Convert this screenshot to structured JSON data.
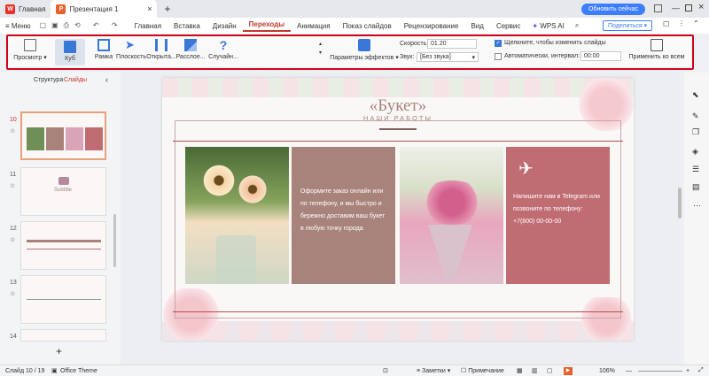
{
  "titlebar": {
    "home_tab": "Главная",
    "doc_tab": "Презентация 1",
    "update_button": "Обновить сейчас",
    "share_button": "Поделиться"
  },
  "menubar": {
    "menu": "Меню",
    "items": [
      "Главная",
      "Вставка",
      "Дизайн",
      "Переходы",
      "Анимация",
      "Показ слайдов",
      "Рецензирование",
      "Вид",
      "Сервис"
    ],
    "wps_ai": "WPS AI"
  },
  "ribbon": {
    "preview": "Просмотр",
    "transitions": [
      "Куб",
      "Рамка",
      "Плоскость",
      "Открыта...",
      "Расслое...",
      "Случайн..."
    ],
    "effect_params": "Параметры эффектов",
    "speed_label": "Скорость:",
    "speed_value": "01.20",
    "sound_label": "Звук:",
    "sound_value": "[Без звука]",
    "click_label": "Щелкните, чтобы изменить слайды",
    "auto_label": "Автоматически, интервал:",
    "auto_value": "00:00",
    "apply_all": "Применить ко всем"
  },
  "sidebar": {
    "tab_structure": "Структура",
    "tab_slides": "Слайды",
    "slides": [
      {
        "num": "10"
      },
      {
        "num": "11",
        "title": "Subtitle"
      },
      {
        "num": "12"
      },
      {
        "num": "13"
      },
      {
        "num": "14"
      }
    ]
  },
  "slide": {
    "title": "«Букет»",
    "subtitle": "НАШИ РАБОТЫ",
    "text_left": "Оформите заказ онлайн или по телефону, и мы быстро и бережно доставим ваш букет в любую точку города.",
    "text_right": "Напишите нам в Telegram или позвоните по телефону: +7(800) 00-00-00"
  },
  "status": {
    "slide_info": "Слайд 10 / 19",
    "theme": "Office Theme",
    "notes": "Заметки",
    "comment": "Примечание",
    "zoom": "106%"
  },
  "colors": {
    "accent": "#c0392b",
    "mauve": "#a8837b",
    "rose": "#c06c73"
  }
}
